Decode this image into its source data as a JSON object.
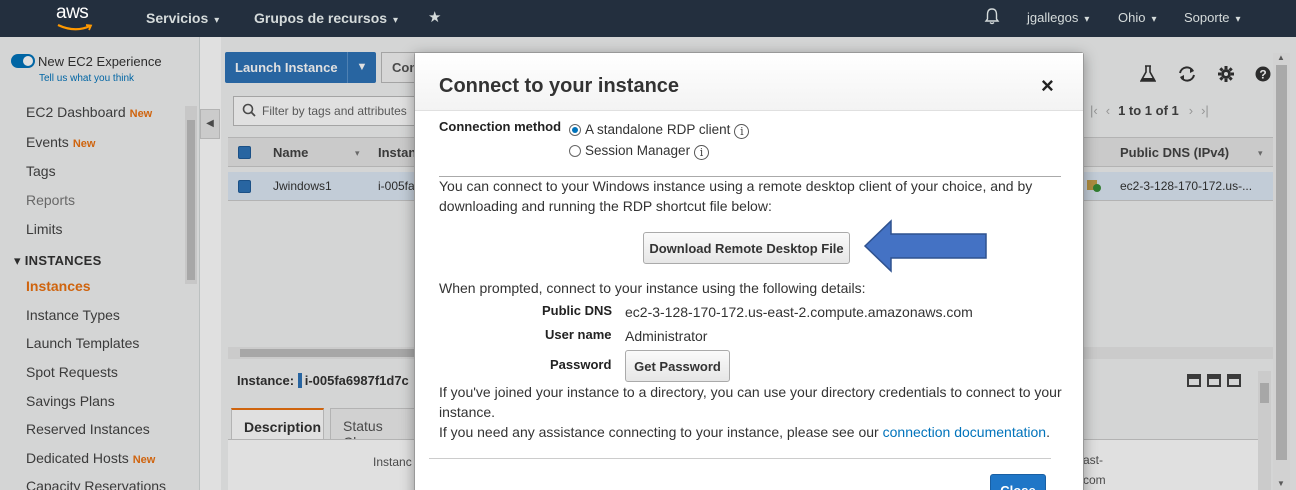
{
  "topnav": {
    "logo": "aws",
    "services": "Servicios",
    "resource_groups": "Grupos de recursos",
    "user": "jgallegos",
    "region": "Ohio",
    "support": "Soporte"
  },
  "sidebar": {
    "new_exp_label": "New EC2 Experience",
    "tell_us": "Tell us what you think",
    "new_badge": "New",
    "items": [
      {
        "label": "EC2 Dashboard",
        "new": true
      },
      {
        "label": "Events",
        "new": true
      },
      {
        "label": "Tags",
        "new": false
      },
      {
        "label": "Reports",
        "new": false
      },
      {
        "label": "Limits",
        "new": false
      }
    ],
    "section": "INSTANCES",
    "section_items": [
      {
        "label": "Instances",
        "new": false
      },
      {
        "label": "Instance Types",
        "new": false
      },
      {
        "label": "Launch Templates",
        "new": false
      },
      {
        "label": "Spot Requests",
        "new": false
      },
      {
        "label": "Savings Plans",
        "new": false
      },
      {
        "label": "Reserved Instances",
        "new": false
      },
      {
        "label": "Dedicated Hosts",
        "new": true
      },
      {
        "label": "Capacity Reservations",
        "new": false
      }
    ]
  },
  "toolbar": {
    "launch": "Launch Instance",
    "connect": "Con",
    "filter_placeholder": "Filter by tags and attributes",
    "pager": "1 to 1 of 1"
  },
  "table": {
    "headers": {
      "name": "Name",
      "instance": "Instan",
      "dns": "Public DNS (IPv4)"
    },
    "row": {
      "name": "Jwindows1",
      "id": "i-005fa",
      "dns": "ec2-3-128-170-172.us-..."
    }
  },
  "details": {
    "instance_label": "Instance:",
    "instance_id": "i-005fa6987f1d7c",
    "tabs": [
      "Description",
      "Status Chec"
    ],
    "instance_text": "Instanc",
    "right_text1": "ast-",
    "right_text2": "com"
  },
  "modal": {
    "title": "Connect to your instance",
    "close_x": "×",
    "connection_method_label": "Connection method",
    "option_rdp": "A standalone RDP client",
    "option_ssm": "Session Manager",
    "info_glyph": "i",
    "intro_line1": "You can connect to your Windows instance using a remote desktop client of your choice, and by",
    "intro_line2": "downloading and running the RDP shortcut file below:",
    "download_button": "Download Remote Desktop File",
    "prompted": "When prompted, connect to your instance using the following details:",
    "public_dns_label": "Public DNS",
    "public_dns_value": "ec2-3-128-170-172.us-east-2.compute.amazonaws.com",
    "username_label": "User name",
    "username_value": "Administrator",
    "password_label": "Password",
    "get_password_button": "Get Password",
    "directory_line1": "If you've joined your instance to a directory, you can use your directory credentials to connect to your",
    "directory_line2": "instance.",
    "assist_text": "If you need any assistance connecting to your instance, please see our",
    "assist_link": "connection documentation",
    "assist_end": ".",
    "close_button": "Close"
  },
  "colors": {
    "nav_bg": "#232f3e",
    "accent_orange": "#ec7211",
    "primary_blue": "#2e73b8",
    "link_blue": "#0073bb",
    "arrow_fill": "#4472c4"
  }
}
